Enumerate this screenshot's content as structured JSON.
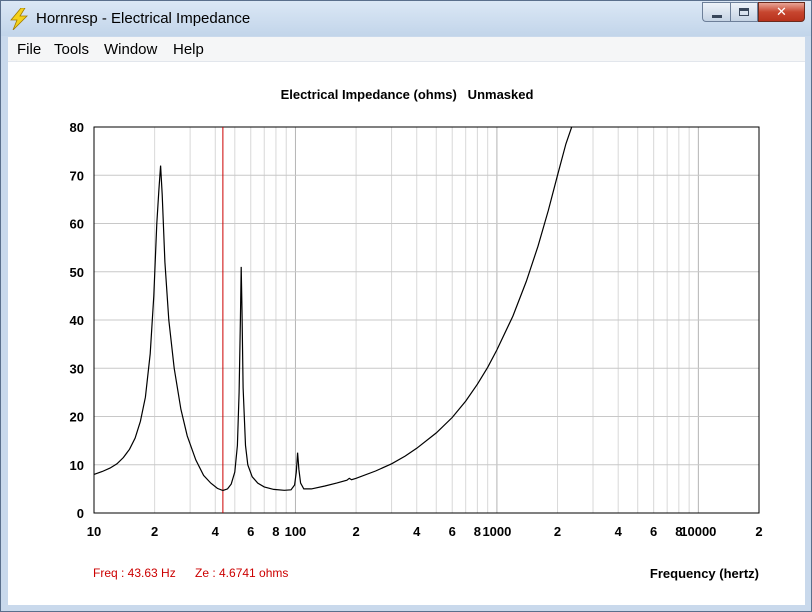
{
  "window": {
    "title": "Hornresp - Electrical Impedance",
    "icon": "lightning-bolt-icon"
  },
  "menu": {
    "file": "File",
    "tools": "Tools",
    "window": "Window",
    "help": "Help"
  },
  "window_buttons": {
    "minimize": "minimize-icon",
    "maximize": "maximize-icon",
    "close": "close-icon"
  },
  "readout": {
    "freq": "Freq : 43.63 Hz",
    "ze": "Ze : 4.6741 ohms"
  },
  "colors": {
    "curve": "#000000",
    "cursor": "#cc0000",
    "grid": "#c8c8c8",
    "readout": "#cc0000"
  },
  "chart_data": {
    "type": "line",
    "title": "Electrical Impedance (ohms)   Unmasked",
    "xlabel": "Frequency (hertz)",
    "ylabel": "",
    "x_scale": "log",
    "xlim": [
      10,
      20000
    ],
    "ylim": [
      0,
      80
    ],
    "grid": true,
    "y_ticks": [
      "0",
      "10",
      "20",
      "30",
      "40",
      "50",
      "60",
      "70",
      "80"
    ],
    "x_tick_labels": [
      {
        "v": 10,
        "t": "10"
      },
      {
        "v": 20,
        "t": "2"
      },
      {
        "v": 40,
        "t": "4"
      },
      {
        "v": 60,
        "t": "6"
      },
      {
        "v": 80,
        "t": "8"
      },
      {
        "v": 100,
        "t": "100"
      },
      {
        "v": 200,
        "t": "2"
      },
      {
        "v": 400,
        "t": "4"
      },
      {
        "v": 600,
        "t": "6"
      },
      {
        "v": 800,
        "t": "8"
      },
      {
        "v": 1000,
        "t": "1000"
      },
      {
        "v": 2000,
        "t": "2"
      },
      {
        "v": 4000,
        "t": "4"
      },
      {
        "v": 6000,
        "t": "6"
      },
      {
        "v": 8000,
        "t": "8"
      },
      {
        "v": 10000,
        "t": "10000"
      },
      {
        "v": 20000,
        "t": "2"
      }
    ],
    "cursor_freq": 43.63,
    "series": [
      {
        "values": [
          [
            10,
            8
          ],
          [
            11,
            8.6
          ],
          [
            12,
            9.3
          ],
          [
            13,
            10.2
          ],
          [
            14,
            11.5
          ],
          [
            15,
            13.2
          ],
          [
            16,
            15.5
          ],
          [
            17,
            19
          ],
          [
            18,
            24
          ],
          [
            19,
            33
          ],
          [
            19.8,
            45
          ],
          [
            20.5,
            60
          ],
          [
            21,
            67
          ],
          [
            21.4,
            72
          ],
          [
            21.8,
            66
          ],
          [
            22.5,
            52
          ],
          [
            23.5,
            40
          ],
          [
            25,
            30
          ],
          [
            27,
            21.5
          ],
          [
            29,
            16
          ],
          [
            32,
            11
          ],
          [
            35,
            7.8
          ],
          [
            38,
            6.2
          ],
          [
            41,
            5.1
          ],
          [
            43.63,
            4.67
          ],
          [
            46,
            5.0
          ],
          [
            48,
            6.0
          ],
          [
            50,
            8.5
          ],
          [
            51.5,
            14
          ],
          [
            52.5,
            25
          ],
          [
            53.3,
            40
          ],
          [
            53.8,
            51
          ],
          [
            54.3,
            42
          ],
          [
            55,
            26
          ],
          [
            56.5,
            14
          ],
          [
            58,
            10
          ],
          [
            61,
            7.5
          ],
          [
            65,
            6.2
          ],
          [
            70,
            5.4
          ],
          [
            78,
            4.9
          ],
          [
            88,
            4.7
          ],
          [
            95,
            4.8
          ],
          [
            99,
            5.8
          ],
          [
            101,
            8.5
          ],
          [
            102.5,
            12.5
          ],
          [
            104,
            9
          ],
          [
            106,
            6.2
          ],
          [
            110,
            5.0
          ],
          [
            120,
            5.0
          ],
          [
            140,
            5.6
          ],
          [
            160,
            6.2
          ],
          [
            180,
            6.8
          ],
          [
            185,
            7.2
          ],
          [
            190,
            6.9
          ],
          [
            200,
            7.2
          ],
          [
            250,
            8.7
          ],
          [
            300,
            10.2
          ],
          [
            350,
            11.8
          ],
          [
            400,
            13.4
          ],
          [
            500,
            16.6
          ],
          [
            600,
            19.8
          ],
          [
            700,
            23.2
          ],
          [
            800,
            26.7
          ],
          [
            900,
            30.2
          ],
          [
            1000,
            33.8
          ],
          [
            1200,
            40.8
          ],
          [
            1400,
            48
          ],
          [
            1600,
            55.3
          ],
          [
            1800,
            62.7
          ],
          [
            2000,
            70
          ],
          [
            2200,
            76.5
          ],
          [
            2350,
            80
          ]
        ]
      }
    ]
  }
}
